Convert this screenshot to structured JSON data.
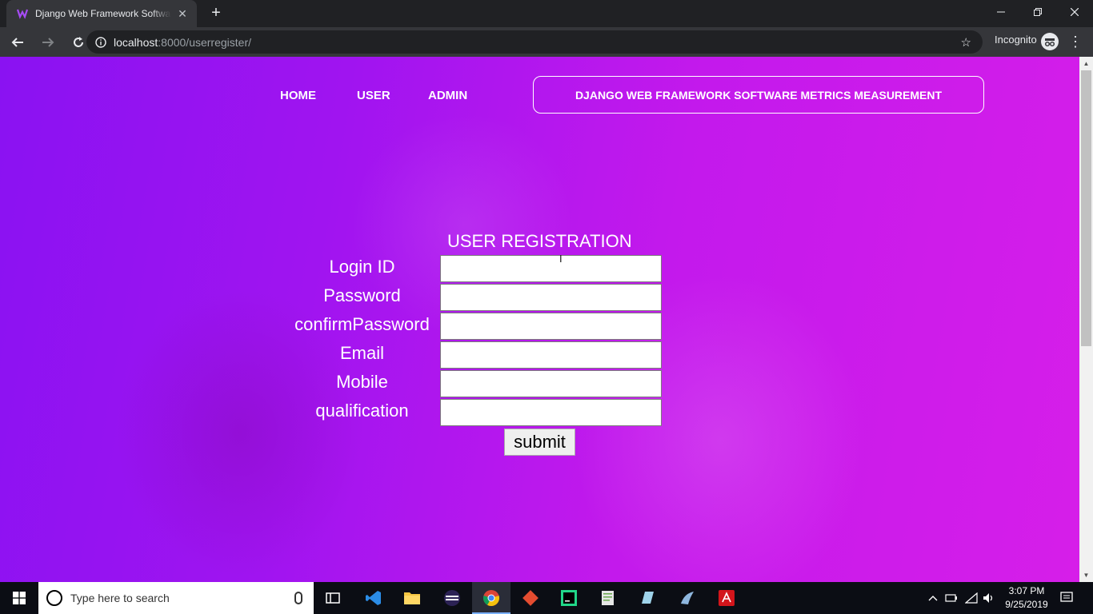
{
  "browser": {
    "tab_title": "Django Web Framework Software Metrics Measurement",
    "tab_close": "✕",
    "new_tab": "+",
    "url_host": "localhost",
    "url_rest": ":8000/userregister/",
    "incognito_label": "Incognito"
  },
  "nav": {
    "home": "HOME",
    "user": "USER",
    "admin": "ADMIN",
    "brand": "DJANGO WEB FRAMEWORK SOFTWARE METRICS MEASUREMENT"
  },
  "form": {
    "title": "USER REGISTRATION",
    "fields": [
      {
        "label": "Login ID",
        "value": ""
      },
      {
        "label": "Password",
        "value": ""
      },
      {
        "label": "confirmPassword",
        "value": ""
      },
      {
        "label": "Email",
        "value": ""
      },
      {
        "label": "Mobile",
        "value": ""
      },
      {
        "label": "qualification",
        "value": ""
      }
    ],
    "submit": "submit"
  },
  "taskbar": {
    "search_placeholder": "Type here to search",
    "time": "3:07 PM",
    "date": "9/25/2019",
    "apps": [
      "task-view-icon",
      "vscode-icon",
      "file-explorer-icon",
      "eclipse-icon",
      "chrome-icon",
      "git-icon",
      "pycharm-icon",
      "notepad-icon",
      "app-icon",
      "mysql-icon",
      "acrobat-icon"
    ]
  },
  "colors": {
    "bg_start": "#8a12f2",
    "bg_end": "#d61ee9",
    "chrome_dark": "#202124",
    "toolbar": "#35363a"
  }
}
